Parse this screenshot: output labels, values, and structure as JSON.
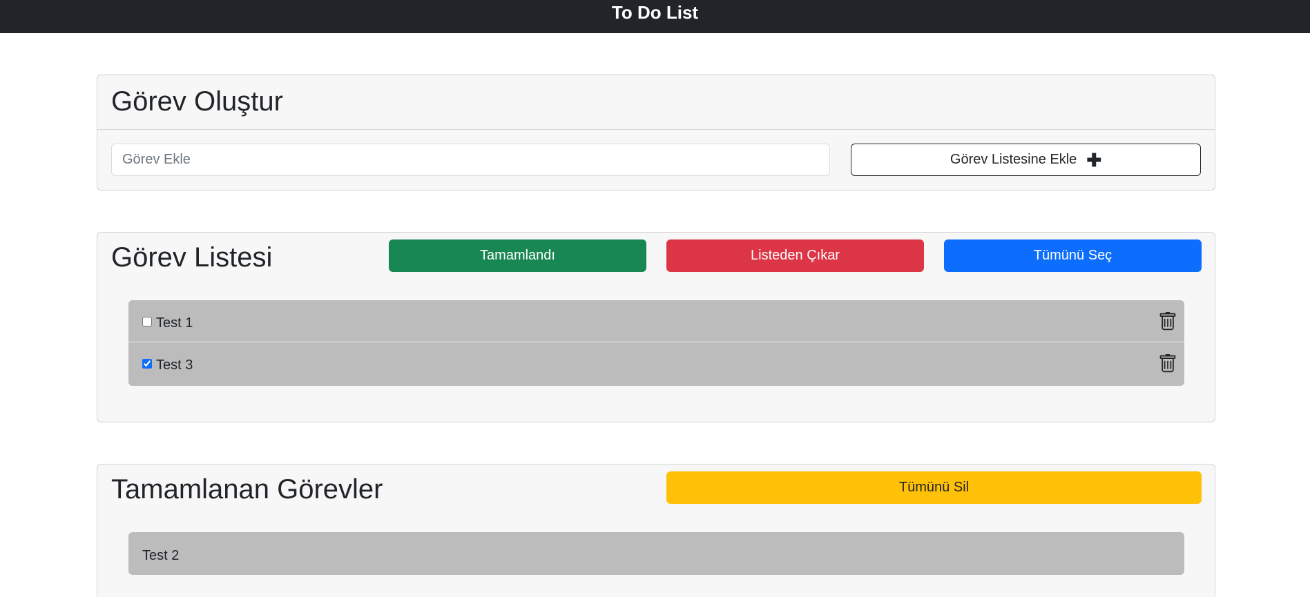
{
  "navbar": {
    "title": "To Do List"
  },
  "create": {
    "title": "Görev Oluştur",
    "input_placeholder": "Görev Ekle",
    "input_value": "",
    "add_button_label": "Görev Listesine Ekle",
    "add_button_icon": "plus-icon"
  },
  "task_list": {
    "title": "Görev Listesi",
    "complete_button_label": "Tamamlandı",
    "remove_button_label": "Listeden Çıkar",
    "select_all_button_label": "Tümünü Seç",
    "items": [
      {
        "label": "Test 1",
        "checked": false,
        "icon": "trash-icon"
      },
      {
        "label": "Test 3",
        "checked": true,
        "icon": "trash-icon"
      }
    ]
  },
  "completed": {
    "title": "Tamamlanan Görevler",
    "delete_all_button_label": "Tümünü Sil",
    "items": [
      {
        "label": "Test 2"
      }
    ]
  },
  "colors": {
    "navbar": "#212529",
    "success": "#198754",
    "danger": "#dc3545",
    "primary": "#0d6efd",
    "warning": "#ffc107",
    "list_item": "#bcbcbc"
  }
}
